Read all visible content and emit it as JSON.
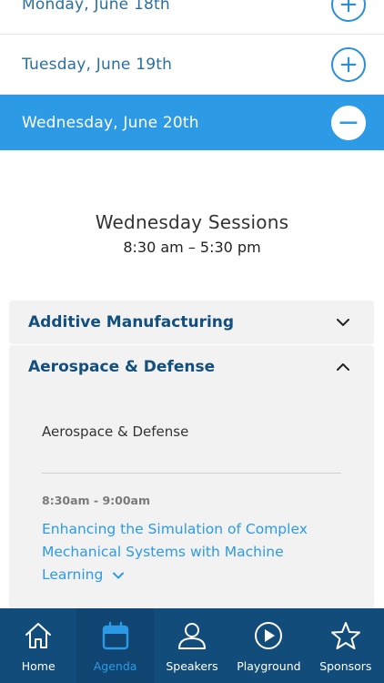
{
  "days": [
    {
      "label": "Monday, June 18th",
      "toggle": "+"
    },
    {
      "label": "Tuesday, June 19th",
      "toggle": "+"
    },
    {
      "label": "Wednesday, June 20th",
      "toggle": "−"
    }
  ],
  "sessions": {
    "title": "Wednesday Sessions",
    "time": "8:30 am – 5:30 pm"
  },
  "tracks": [
    {
      "title": "Additive Manufacturing",
      "expanded": false
    },
    {
      "title": "Aerospace & Defense",
      "expanded": true,
      "description": "Aerospace & Defense",
      "session": {
        "time": "8:30am - 9:00am",
        "title": "Enhancing the Simulation of Complex Mechanical Systems with Machine Learning"
      }
    }
  ],
  "tabbar": {
    "items": [
      {
        "label": "Home",
        "icon": "home-icon"
      },
      {
        "label": "Agenda",
        "icon": "calendar-icon",
        "active": true
      },
      {
        "label": "Speakers",
        "icon": "person-icon"
      },
      {
        "label": "Playground",
        "icon": "play-icon"
      },
      {
        "label": "Sponsors",
        "icon": "star-icon"
      }
    ]
  },
  "colors": {
    "accent": "#2d9ae6",
    "navy": "#124c7a",
    "track_title": "#124e7e"
  }
}
